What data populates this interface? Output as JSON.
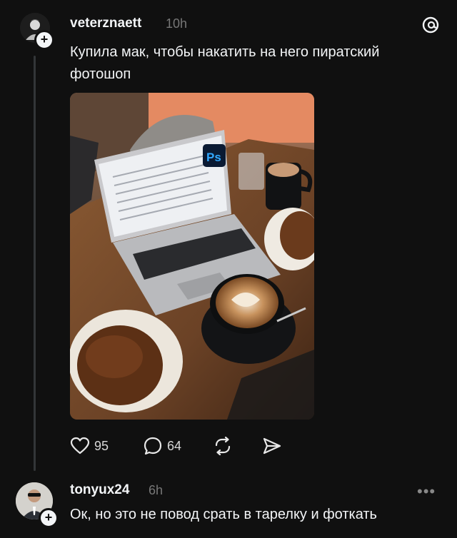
{
  "post": {
    "username": "veterznaett",
    "time": "10h",
    "text": "Купила мак, чтобы накатить на него пиратский фотошоп",
    "photo_app_badge": "Ps",
    "likes": "95",
    "comments": "64"
  },
  "reply": {
    "username": "tonyux24",
    "time": "6h",
    "text": "Ок, но это не повод срать в тарелку и фоткать",
    "more": "•••"
  },
  "icons": {
    "app_logo": "threads-icon",
    "like": "heart-icon",
    "comment": "comment-bubble-icon",
    "repost": "repost-icon",
    "share": "send-icon",
    "follow": "plus-icon"
  }
}
